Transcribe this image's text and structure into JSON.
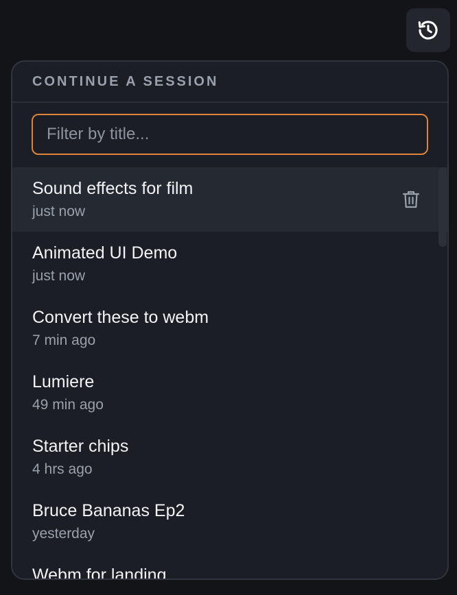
{
  "panel": {
    "header": "CONTINUE A SESSION",
    "filter_placeholder": "Filter by title...",
    "filter_value": ""
  },
  "sessions": [
    {
      "title": "Sound effects for film",
      "time": "just now"
    },
    {
      "title": "Animated UI Demo",
      "time": "just now"
    },
    {
      "title": "Convert these to webm",
      "time": "7 min ago"
    },
    {
      "title": "Lumiere",
      "time": "49 min ago"
    },
    {
      "title": "Starter chips",
      "time": "4 hrs ago"
    },
    {
      "title": "Bruce Bananas Ep2",
      "time": "yesterday"
    },
    {
      "title": "Webm for landing",
      "time": ""
    }
  ],
  "icons": {
    "history": "history-icon",
    "delete": "trash-icon"
  },
  "colors": {
    "accent": "#e0833b",
    "background": "#121418",
    "panel": "#1b1e25",
    "hover_row": "#252932"
  }
}
